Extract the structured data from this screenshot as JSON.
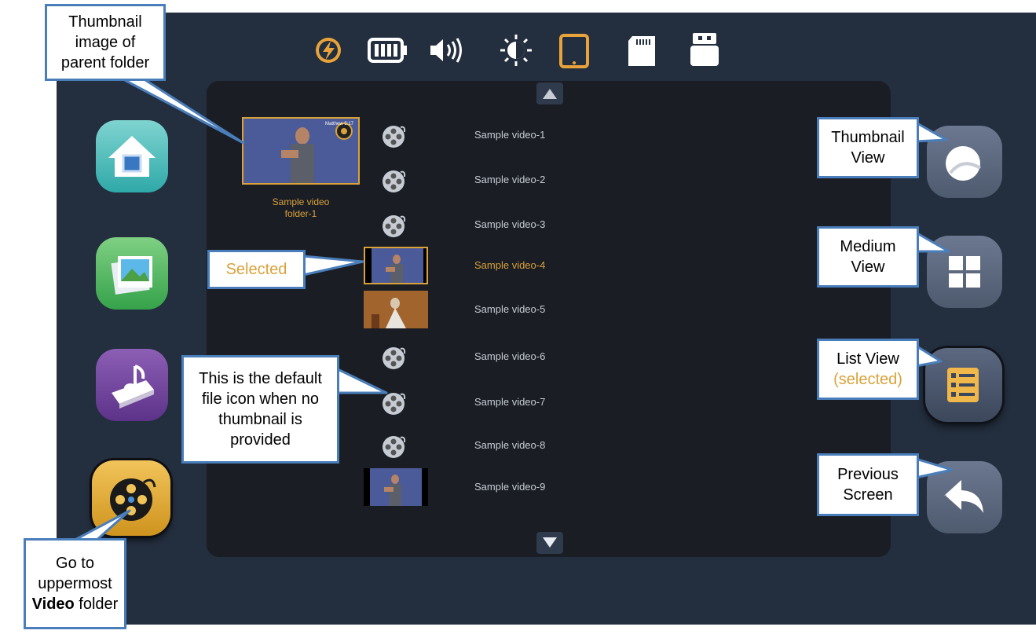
{
  "folder": {
    "label_line1": "Sample video",
    "label_line2": "folder-1",
    "thumb_caption": "Matthew 5:17"
  },
  "files": [
    {
      "name": "Sample video-1"
    },
    {
      "name": "Sample video-2"
    },
    {
      "name": "Sample video-3"
    },
    {
      "name": "Sample video-4"
    },
    {
      "name": "Sample video-5"
    },
    {
      "name": "Sample video-6"
    },
    {
      "name": "Sample video-7"
    },
    {
      "name": "Sample video-8"
    },
    {
      "name": "Sample video-9"
    }
  ],
  "status_icons": [
    "lightning-icon",
    "battery-icon",
    "volume-icon",
    "brightness-icon",
    "tablet-icon",
    "sd-card-icon",
    "usb-drive-icon"
  ],
  "side_buttons": [
    "home-icon",
    "photo-icon",
    "music-book-icon",
    "film-reel-icon"
  ],
  "right_buttons": [
    "thumbnail-view-icon",
    "medium-view-icon",
    "list-view-icon",
    "back-arrow-icon"
  ],
  "callouts": {
    "folder_thumb": [
      "Thumbnail",
      "image of",
      "parent folder"
    ],
    "selected": "Selected",
    "default_icon": [
      "This is the default",
      "file icon when no",
      "thumbnail is",
      "provided"
    ],
    "video_folder": {
      "line1": "Go to",
      "line2": "uppermost",
      "bold": "Video",
      "rest": " folder"
    },
    "thumbnail_view": [
      "Thumbnail",
      "View"
    ],
    "medium_view": [
      "Medium",
      "View"
    ],
    "list_view": {
      "line1": "List View",
      "line2": "(selected)"
    },
    "previous_screen": [
      "Previous",
      "Screen"
    ]
  },
  "colors": {
    "background": "#232e3e",
    "panel": "#1a1d24",
    "accent_gold": "#d9a23a",
    "callout_border": "#4a7ebb"
  }
}
